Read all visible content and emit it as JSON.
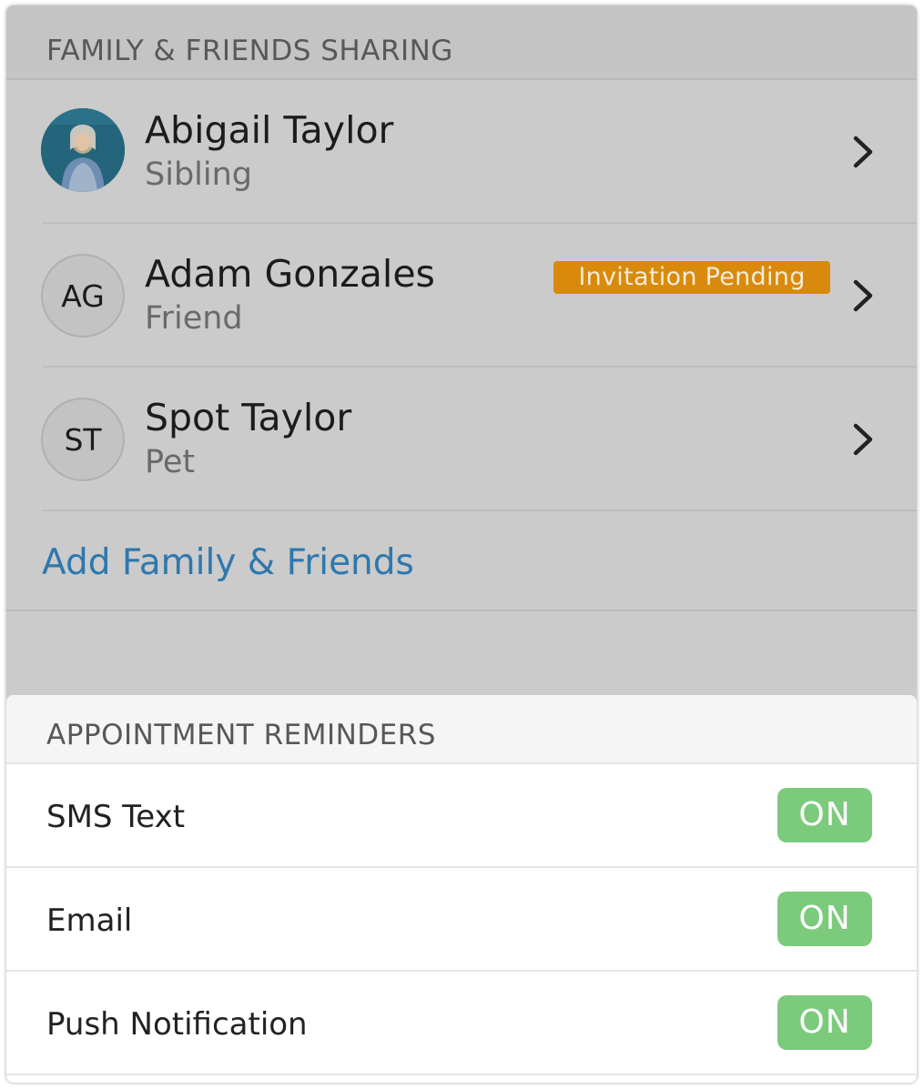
{
  "family_section": {
    "title": "FAMILY & FRIENDS SHARING",
    "members": [
      {
        "name": "Abigail Taylor",
        "relation": "Sibling",
        "avatar": "photo"
      },
      {
        "name": "Adam Gonzales",
        "relation": "Friend",
        "initials": "AG",
        "badge": "Invitation Pending"
      },
      {
        "name": "Spot Taylor",
        "relation": "Pet",
        "initials": "ST"
      }
    ],
    "add_link": "Add Family & Friends"
  },
  "reminders_section": {
    "title": "APPOINTMENT REMINDERS",
    "settings": [
      {
        "label": "SMS Text",
        "state": "ON"
      },
      {
        "label": "Email",
        "state": "ON"
      },
      {
        "label": "Push Notification",
        "state": "ON"
      }
    ]
  },
  "colors": {
    "link": "#2e78ac",
    "badge": "#d98a0c",
    "toggle_on": "#7cca7c"
  },
  "icons": {
    "row_chevron": "chevron-right-icon"
  }
}
